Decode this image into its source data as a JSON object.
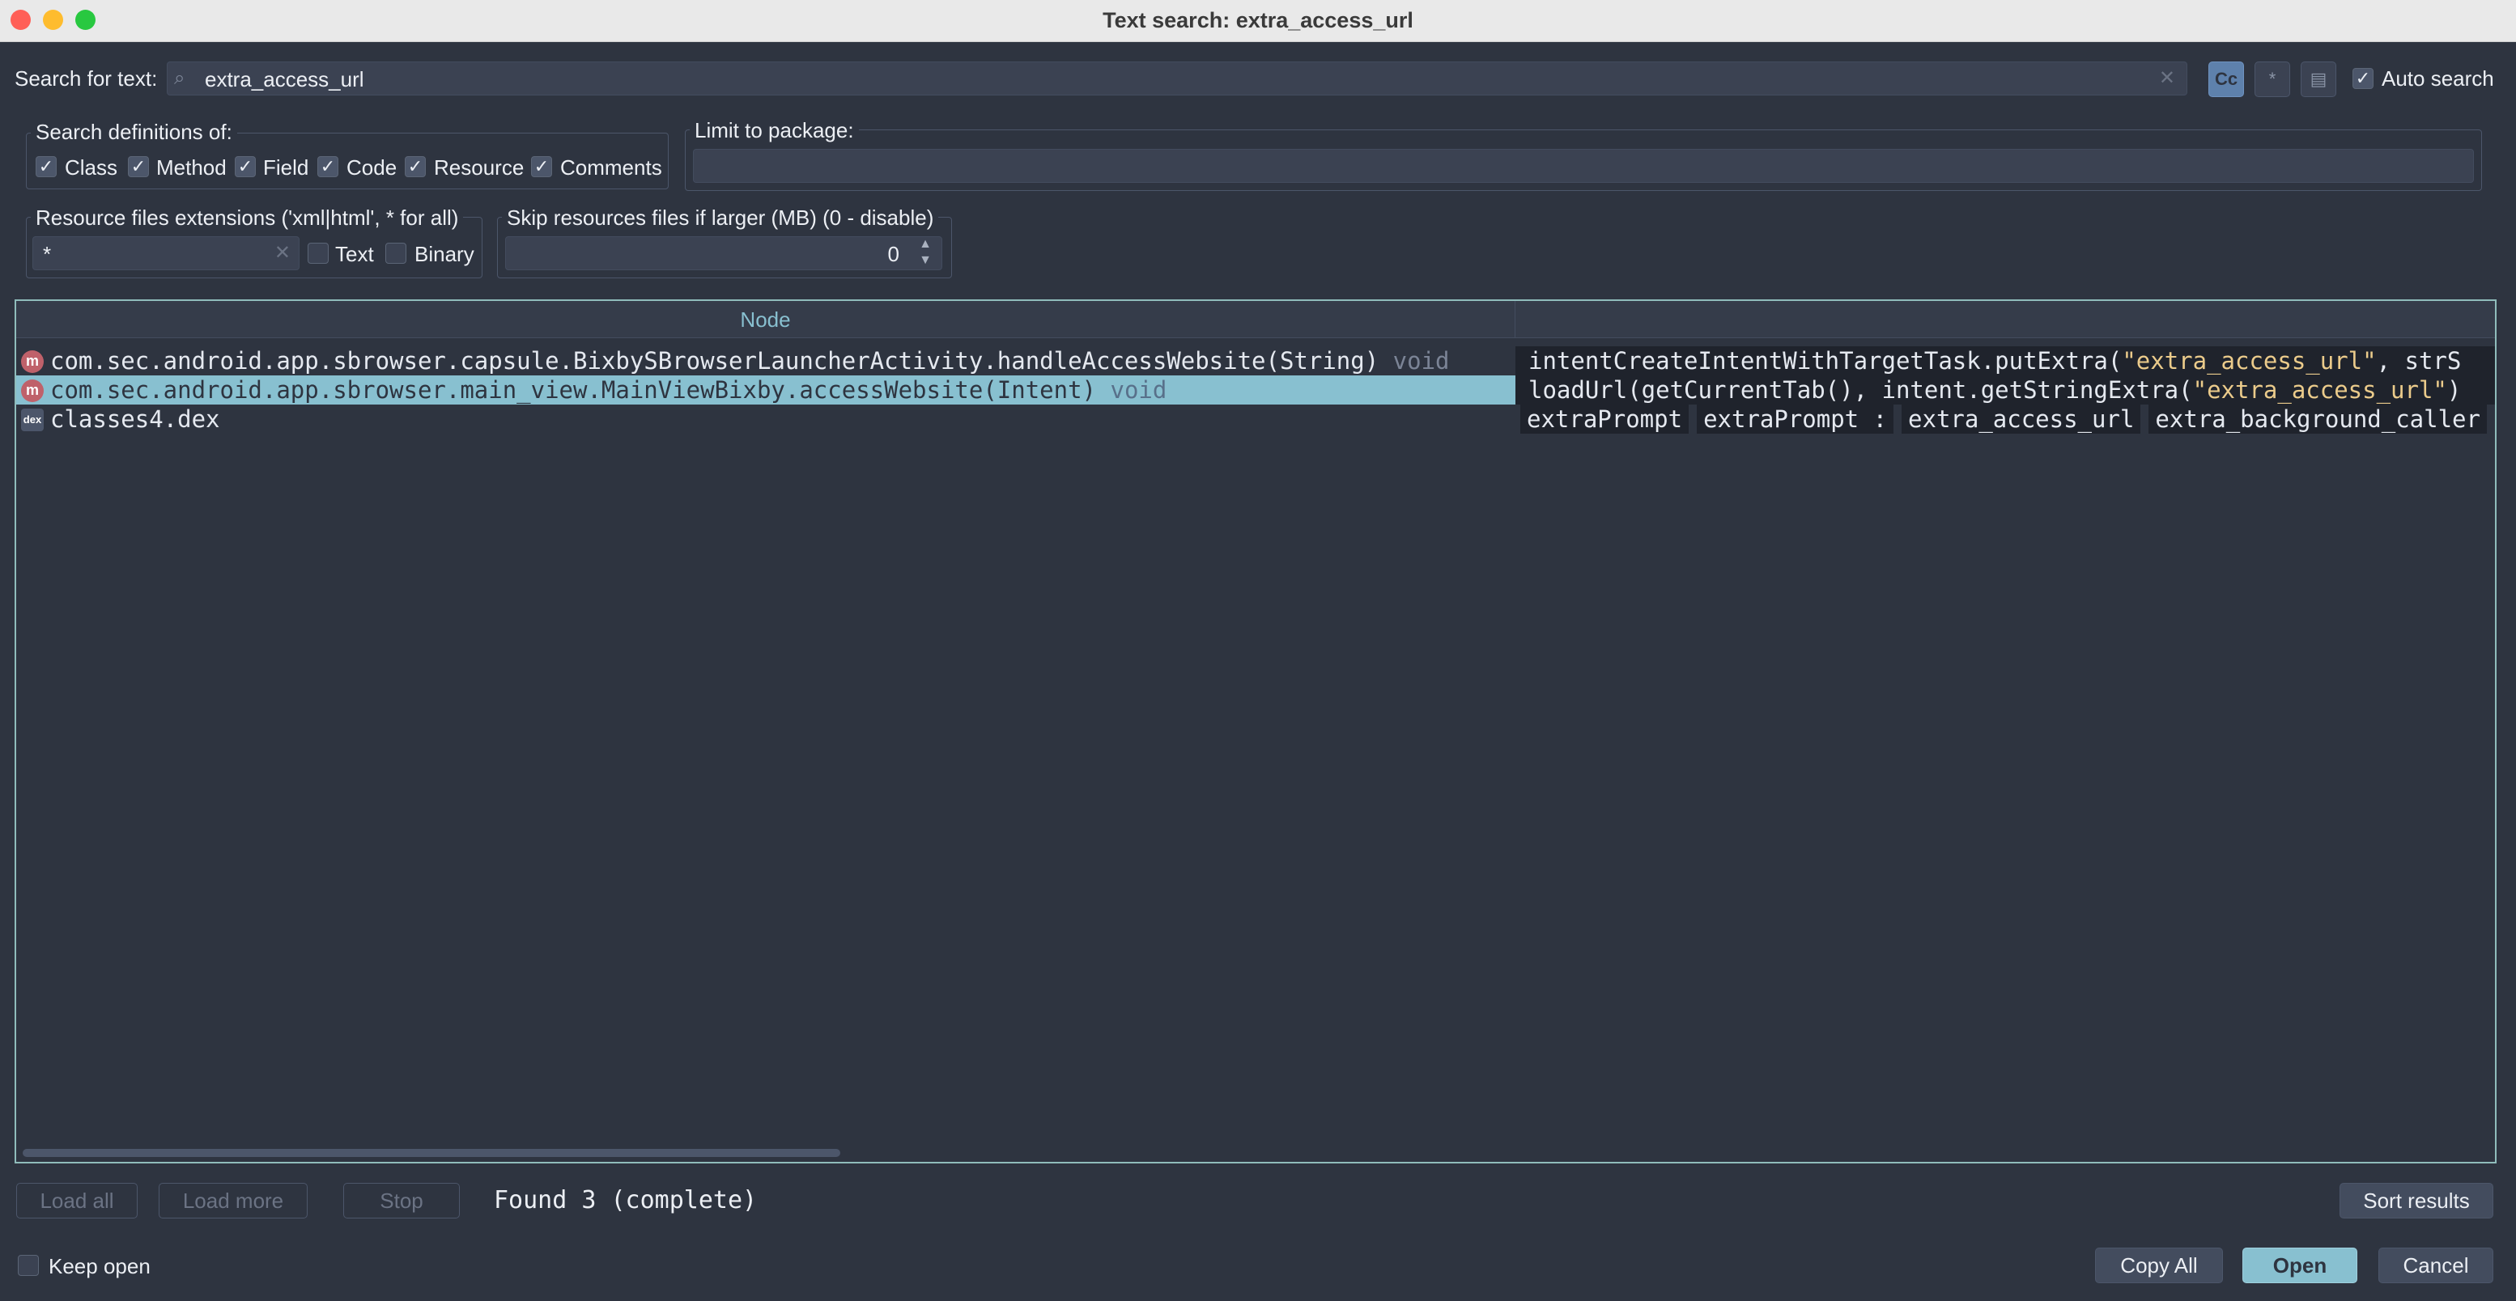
{
  "window": {
    "title": "Text search: extra_access_url"
  },
  "search": {
    "label": "Search for text:",
    "value": "extra_access_url",
    "case_sensitive_label": "Cc",
    "regex_label": "*",
    "auto_search_label": "Auto search",
    "auto_search_checked": true
  },
  "definitions": {
    "legend": "Search definitions of:",
    "options": [
      {
        "label": "Class",
        "checked": true
      },
      {
        "label": "Method",
        "checked": true
      },
      {
        "label": "Field",
        "checked": true
      },
      {
        "label": "Code",
        "checked": true
      },
      {
        "label": "Resource",
        "checked": true
      },
      {
        "label": "Comments",
        "checked": true
      }
    ]
  },
  "package": {
    "legend": "Limit to package:",
    "value": ""
  },
  "resource_ext": {
    "legend": "Resource files extensions ('xml|html', * for all)",
    "value": "*",
    "text_label": "Text",
    "binary_label": "Binary"
  },
  "skip_resources": {
    "legend": "Skip resources files if larger (MB) (0 - disable)",
    "value": "0"
  },
  "results": {
    "header_node": "Node",
    "rows": [
      {
        "icon": "m",
        "node": "com.sec.android.app.sbrowser.capsule.BixbySBrowserLauncherActivity.handleAccessWebsite(String)",
        "ret": "void",
        "code_pre": "intentCreateIntentWithTargetTask.putExtra(",
        "code_hl": "\"extra_access_url\"",
        "code_post": ", strS"
      },
      {
        "icon": "m",
        "node": "com.sec.android.app.sbrowser.main_view.MainViewBixby.accessWebsite(Intent)",
        "ret": "void",
        "code_pre": "loadUrl(getCurrentTab(), intent.getStringExtra(",
        "code_hl": "\"extra_access_url\"",
        "code_post": ")"
      },
      {
        "icon": "dex",
        "node": "classes4.dex",
        "ret": "",
        "chips": [
          "extraPrompt",
          "extraPrompt :",
          "extra_access_url",
          "extra_background_caller"
        ]
      }
    ]
  },
  "footer": {
    "load_all": "Load all",
    "load_more": "Load more",
    "stop": "Stop",
    "status": "Found 3 (complete)",
    "sort_results": "Sort results",
    "keep_open": "Keep open",
    "copy_all": "Copy All",
    "open": "Open",
    "cancel": "Cancel"
  },
  "colors": {
    "background": "#2e3440",
    "accent": "#88c0d0",
    "highlight": "#ebcb8b",
    "method_icon": "#bf616a"
  },
  "icons": [
    "magnifier-icon",
    "clear-icon",
    "case-sensitive-icon",
    "regex-icon",
    "active-tab-icon",
    "method-icon",
    "dex-file-icon",
    "spinner-up-icon",
    "spinner-down-icon"
  ]
}
